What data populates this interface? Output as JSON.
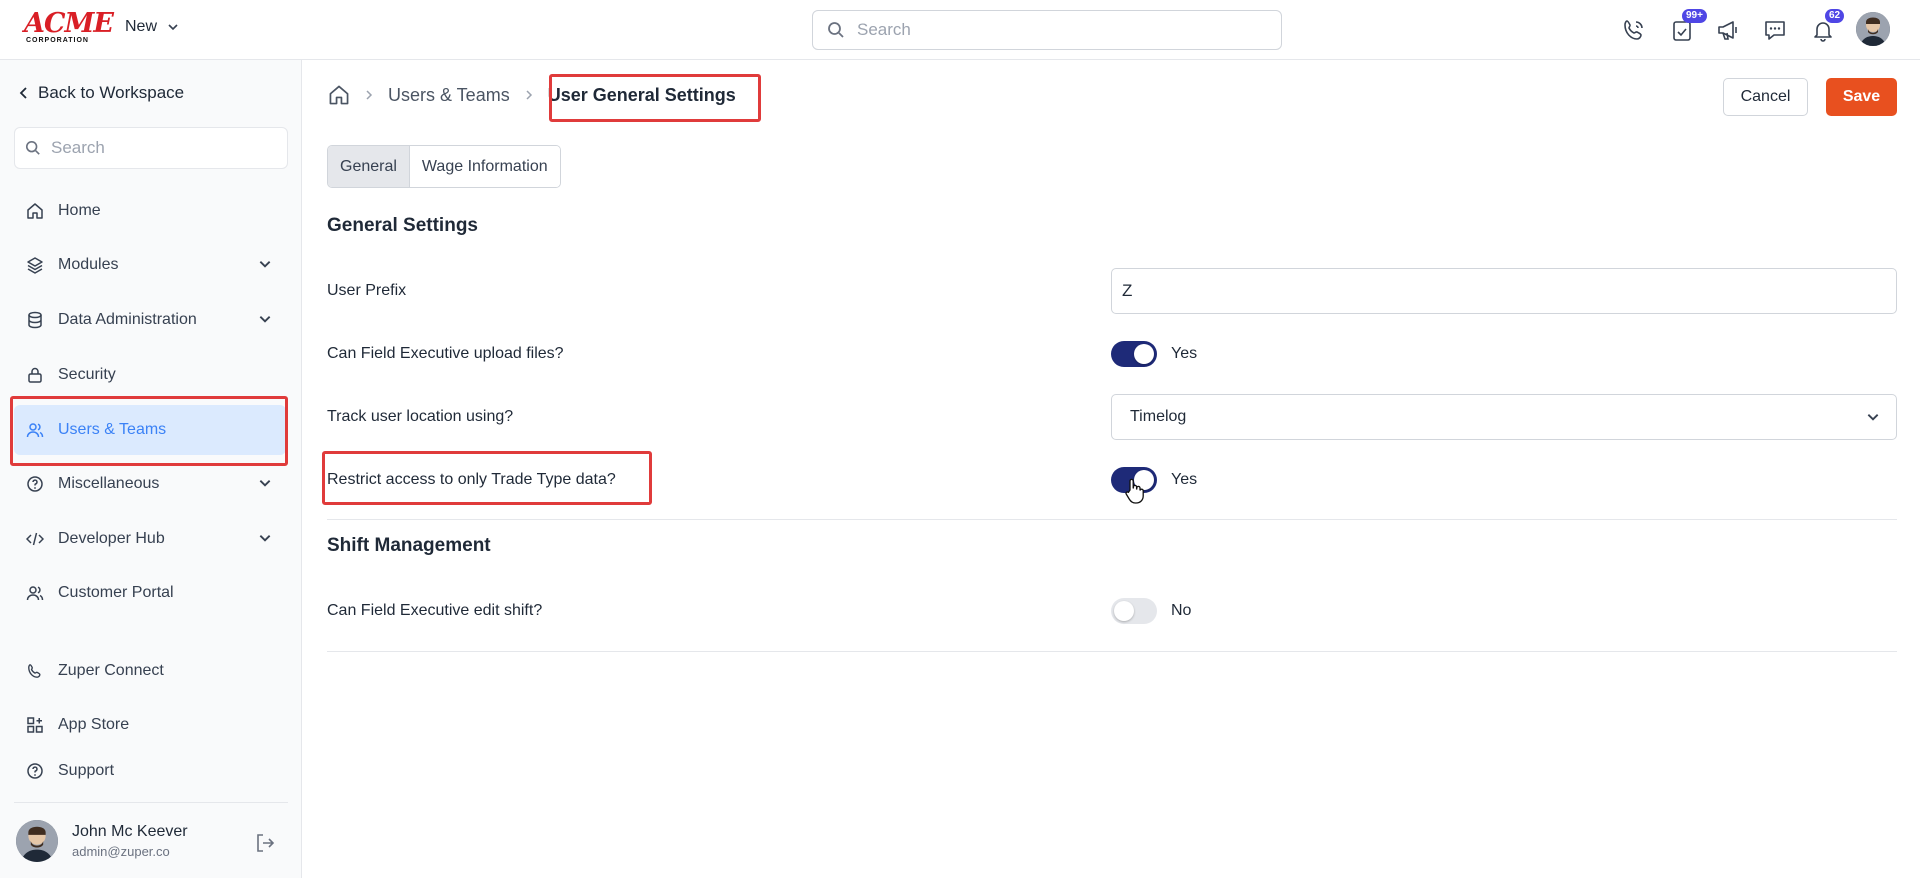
{
  "topbar": {
    "logo_main": "ACME",
    "logo_sub": "CORPORATION",
    "new_label": "New",
    "search_placeholder": "Search",
    "tasks_badge": "99+",
    "notifications_badge": "62"
  },
  "sidebar": {
    "back_label": "Back to Workspace",
    "search_placeholder": "Search",
    "items": [
      {
        "label": "Home"
      },
      {
        "label": "Modules"
      },
      {
        "label": "Data Administration"
      },
      {
        "label": "Security"
      },
      {
        "label": "Users & Teams"
      },
      {
        "label": "Miscellaneous"
      },
      {
        "label": "Developer Hub"
      },
      {
        "label": "Customer Portal"
      },
      {
        "label": "Zuper Connect"
      },
      {
        "label": "App Store"
      },
      {
        "label": "Support"
      }
    ],
    "user": {
      "name": "John Mc Keever",
      "email": "admin@zuper.co"
    }
  },
  "breadcrumb": {
    "parent": "Users & Teams",
    "current": "User General Settings"
  },
  "actions": {
    "cancel_label": "Cancel",
    "save_label": "Save"
  },
  "tabs": [
    {
      "label": "General"
    },
    {
      "label": "Wage Information"
    }
  ],
  "general": {
    "title": "General Settings",
    "user_prefix_label": "User Prefix",
    "user_prefix_value": "Z",
    "upload_label": "Can Field Executive upload files?",
    "upload_value": "Yes",
    "track_label": "Track user location using?",
    "track_value": "Timelog",
    "restrict_label": "Restrict access to only Trade Type data?",
    "restrict_value": "Yes"
  },
  "shift": {
    "title": "Shift Management",
    "edit_label": "Can Field Executive edit shift?",
    "edit_value": "No"
  },
  "colors": {
    "accent": "#e8501f",
    "toggle_on": "#1e2a78",
    "active_nav_bg": "#dbeafe",
    "active_nav_text": "#3b82f6",
    "highlight": "#e03b3b"
  }
}
